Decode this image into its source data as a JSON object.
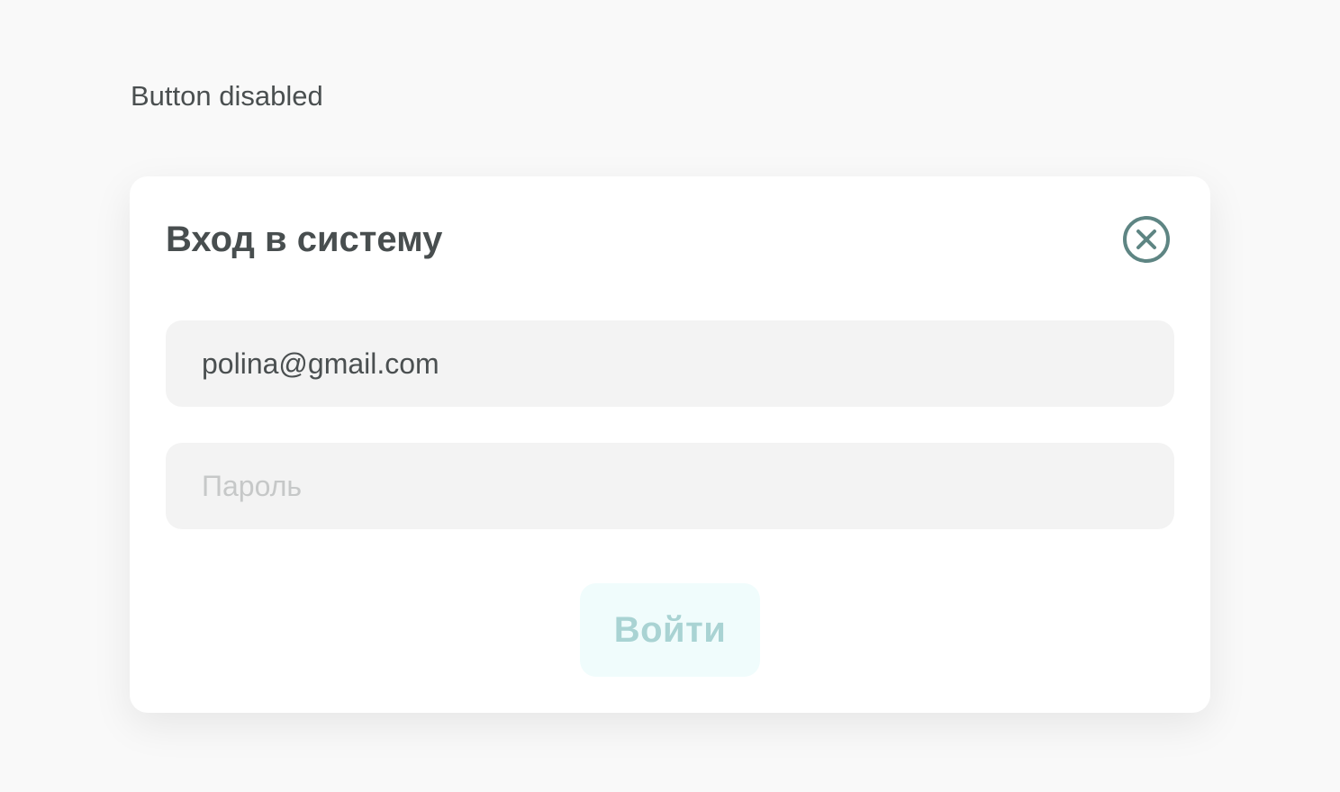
{
  "page": {
    "caption": "Button disabled"
  },
  "modal": {
    "title": "Вход в систему",
    "close_icon": "close-circle-icon",
    "email": {
      "value": "polina@gmail.com",
      "placeholder": ""
    },
    "password": {
      "value": "",
      "placeholder": "Пароль"
    },
    "submit": {
      "label": "Войти",
      "state": "disabled"
    }
  },
  "colors": {
    "background": "#f9f9f9",
    "card": "#ffffff",
    "input_bg": "#f3f3f3",
    "text": "#4a4f50",
    "close_icon": "#5e8583",
    "button_disabled_bg": "#f0fcfc",
    "button_disabled_text": "#a9d3d3"
  }
}
